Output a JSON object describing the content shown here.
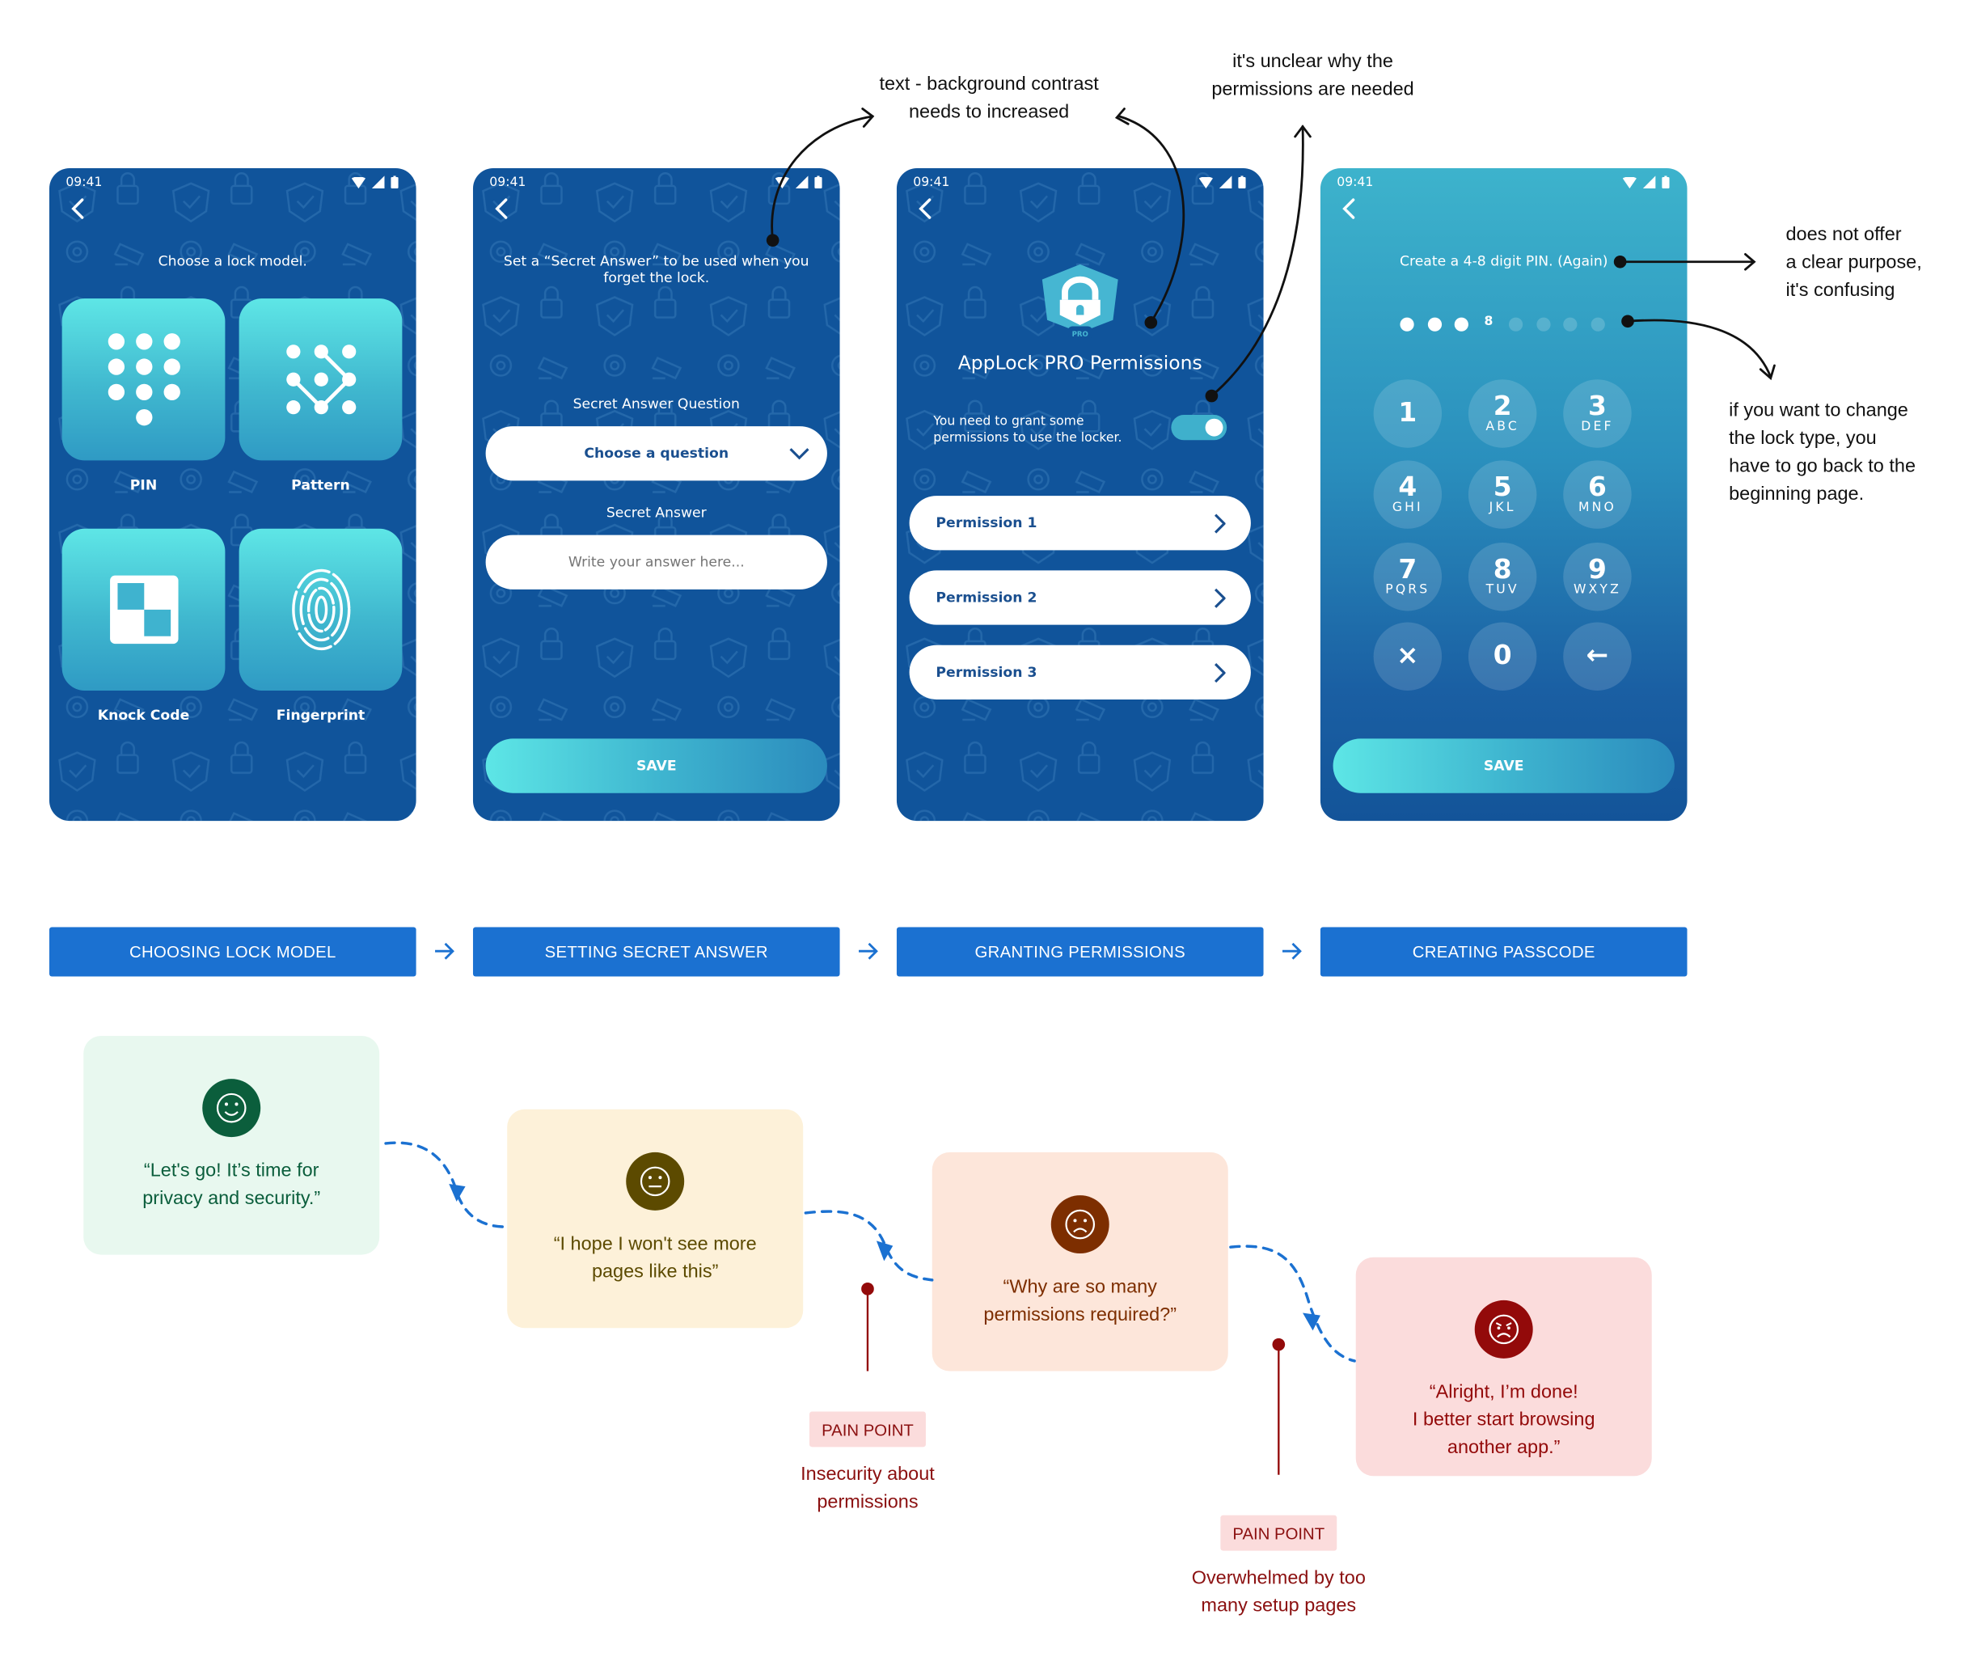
{
  "screens": [
    {
      "status_time": "09:41",
      "title": "Choose a lock model.",
      "options": [
        {
          "label": "PIN",
          "icon": "pin-keypad-icon"
        },
        {
          "label": "Pattern",
          "icon": "pattern-icon"
        },
        {
          "label": "Knock Code",
          "icon": "knock-code-icon"
        },
        {
          "label": "Fingerprint",
          "icon": "fingerprint-icon"
        }
      ]
    },
    {
      "status_time": "09:41",
      "title_line1": "Set a “Secret Answer” to be used when you",
      "title_line2": "forget the lock.",
      "question_label": "Secret Answer Question",
      "question_select": "Choose a question",
      "answer_label": "Secret Answer",
      "answer_placeholder": "Write your answer here...",
      "answer_value": "",
      "save_label": "SAVE"
    },
    {
      "status_time": "09:41",
      "badge_text": "PRO",
      "title": "AppLock PRO Permissions",
      "toggle_text_line1": "You need to grant some",
      "toggle_text_line2": "permissions to use the locker.",
      "toggle_on": true,
      "permissions": [
        "Permission 1",
        "Permission 2",
        "Permission 3"
      ]
    },
    {
      "status_time": "09:41",
      "title": "Create a 4-8 digit PIN. (Again)",
      "pin_filled": 3,
      "pin_marker": "8",
      "pin_empty": 4,
      "keys": [
        {
          "digit": "1",
          "letters": ""
        },
        {
          "digit": "2",
          "letters": "ABC"
        },
        {
          "digit": "3",
          "letters": "DEF"
        },
        {
          "digit": "4",
          "letters": "GHI"
        },
        {
          "digit": "5",
          "letters": "JKL"
        },
        {
          "digit": "6",
          "letters": "MNO"
        },
        {
          "digit": "7",
          "letters": "PQRS"
        },
        {
          "digit": "8",
          "letters": "TUV"
        },
        {
          "digit": "9",
          "letters": "WXYZ"
        },
        {
          "digit": "×",
          "letters": ""
        },
        {
          "digit": "0",
          "letters": ""
        },
        {
          "digit": "←",
          "letters": ""
        }
      ],
      "save_label": "SAVE"
    }
  ],
  "stages": [
    "CHOOSING LOCK MODEL",
    "SETTING SECRET ANSWER",
    "GRANTING PERMISSIONS",
    "CREATING PASSCODE"
  ],
  "annotations": {
    "contrast_line1": "text - background contrast",
    "contrast_line2": "needs to increased",
    "permissions_line1": "it's unclear why the",
    "permissions_line2": "permissions are needed",
    "purpose_line1": "does not offer",
    "purpose_line2": "a clear purpose,",
    "purpose_line3": "it's confusing",
    "locktype_line1": "if you want to change",
    "locktype_line2": "the lock type, you",
    "locktype_line3": "have to go back to the",
    "locktype_line4": "beginning page."
  },
  "emotions": [
    {
      "mood": "happy",
      "line1": "“Let's go! It’s time for",
      "line2": "privacy and security.”",
      "line3": "",
      "bg": "#e8f8ef",
      "face": "#0b5e3c",
      "text": "#0b5e3c"
    },
    {
      "mood": "neutral",
      "line1": "“I hope I won't see more",
      "line2": "pages like this”",
      "line3": "",
      "bg": "#fdf1d9",
      "face": "#5c4a00",
      "text": "#5c4a00"
    },
    {
      "mood": "sad",
      "line1": "“Why are so many",
      "line2": "permissions required?”",
      "line3": "",
      "bg": "#fde6da",
      "face": "#7d2e00",
      "text": "#7d2e00"
    },
    {
      "mood": "angry",
      "line1": "“Alright, I’m done!",
      "line2": "I better start browsing",
      "line3": "another app.”",
      "bg": "#fbdcdc",
      "face": "#930a0a",
      "text": "#930a0a"
    }
  ],
  "pain_points": [
    {
      "badge": "PAIN POINT",
      "line1": "Insecurity about",
      "line2": "permissions"
    },
    {
      "badge": "PAIN POINT",
      "line1": "Overwhelmed by too",
      "line2": "many setup pages"
    }
  ],
  "colors": {
    "phone_bg": "#10549b",
    "tile_gradient_top": "#5ee6e6",
    "stage_blue": "#1b71d1",
    "flow_dash": "#1b71d1",
    "pain_red": "#8b1010"
  }
}
